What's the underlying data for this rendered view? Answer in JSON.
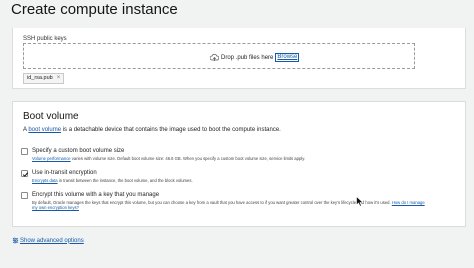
{
  "page": {
    "title": "Create compute instance"
  },
  "ssh": {
    "label": "SSH public keys",
    "drop_text": "Drop .pub files here",
    "browse_label": "Browse",
    "file_chip": "id_rsa.pub",
    "remove_symbol": "×"
  },
  "boot": {
    "title": "Boot volume",
    "intro_prefix": "A ",
    "intro_link": "boot volume",
    "intro_suffix": " is a detachable device that contains the image used to boot the compute instance.",
    "options": [
      {
        "label": "Specify a custom boot volume size",
        "desc_link": "Volume performance",
        "desc": " varies with volume size. Default boot volume size: 46.6 GB. When you specify a custom boot volume size, service limits apply.",
        "checked": false
      },
      {
        "label": "Use in-transit encryption",
        "desc_link": "Encrypts data",
        "desc": " in transit between the instance, the boot volume, and the block volumes.",
        "checked": true
      },
      {
        "label": "Encrypt this volume with a key that you manage",
        "desc": "By default, Oracle manages the keys that encrypt this volume, but you can choose a key from a vault that you have access to if you want greater control over the key's lifecycle and how it's used.",
        "desc_link": "How do I manage",
        "desc_line2": "my own encryption keys?",
        "checked": false
      }
    ]
  },
  "advanced": {
    "label": "Show advanced options"
  },
  "colors": {
    "link": "#1559a8",
    "background": "#f1f2f2"
  }
}
